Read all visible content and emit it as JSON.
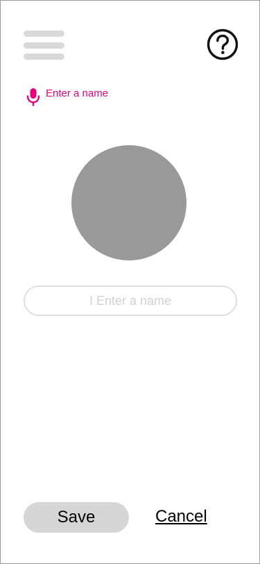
{
  "header": {
    "menu_icon": "hamburger-menu-icon",
    "help_icon": "question-mark-circle-icon"
  },
  "voice_prompt": {
    "icon": "microphone-icon",
    "label": "Enter a name",
    "color": "#e6007e"
  },
  "avatar": {
    "color": "#999999"
  },
  "name_input": {
    "value": "",
    "placeholder": "I Enter a name"
  },
  "actions": {
    "save_label": "Save",
    "cancel_label": "Cancel"
  }
}
